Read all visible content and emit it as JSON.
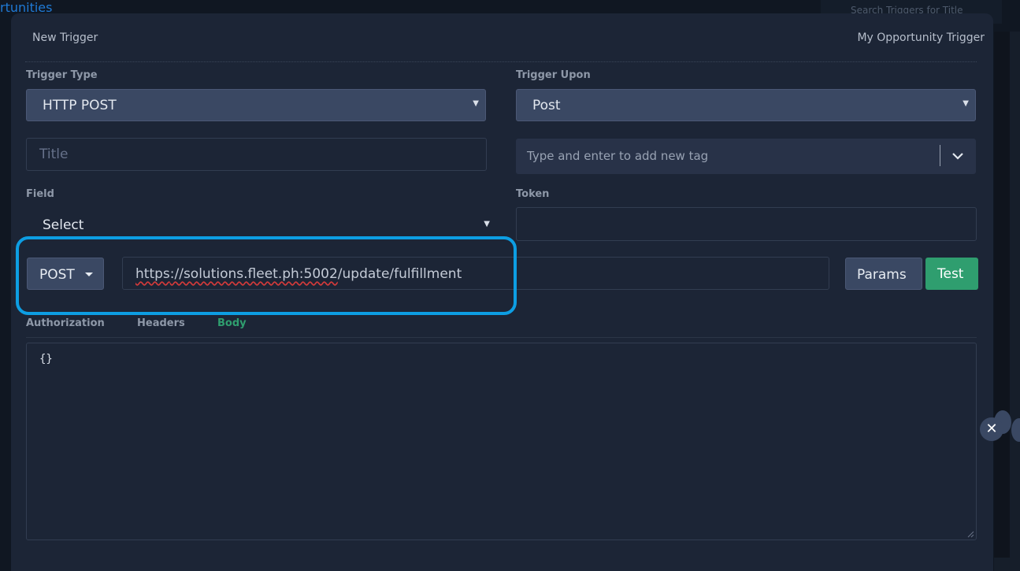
{
  "background": {
    "link_text": "rtunities",
    "search_placeholder": "Search Triggers for Title"
  },
  "modal": {
    "title": "New Trigger",
    "name": "My Opportunity Trigger"
  },
  "trigger_type": {
    "label": "Trigger Type",
    "value": "HTTP POST"
  },
  "trigger_upon": {
    "label": "Trigger Upon",
    "value": "Post"
  },
  "title_field": {
    "placeholder": "Title"
  },
  "tags": {
    "placeholder": "Type and enter to add new tag"
  },
  "field": {
    "label": "Field",
    "value": "Select"
  },
  "token": {
    "label": "Token",
    "value": ""
  },
  "request": {
    "method": "POST",
    "url_scheme": "https",
    "url_host": "://solutions.fleet.ph:5002",
    "url_path": "/update/fulfillment",
    "params_label": "Params",
    "test_label": "Test"
  },
  "tabs": [
    {
      "label": "Authorization",
      "active": false
    },
    {
      "label": "Headers",
      "active": false
    },
    {
      "label": "Body",
      "active": true
    }
  ],
  "body": {
    "content": "{}"
  },
  "colors": {
    "accent_green": "#2f9e6f",
    "highlight_blue": "#0d9ee3",
    "modal_bg": "#1c2536"
  },
  "icons": {
    "dropdown": "chevron-down-icon",
    "close": "close-icon"
  }
}
